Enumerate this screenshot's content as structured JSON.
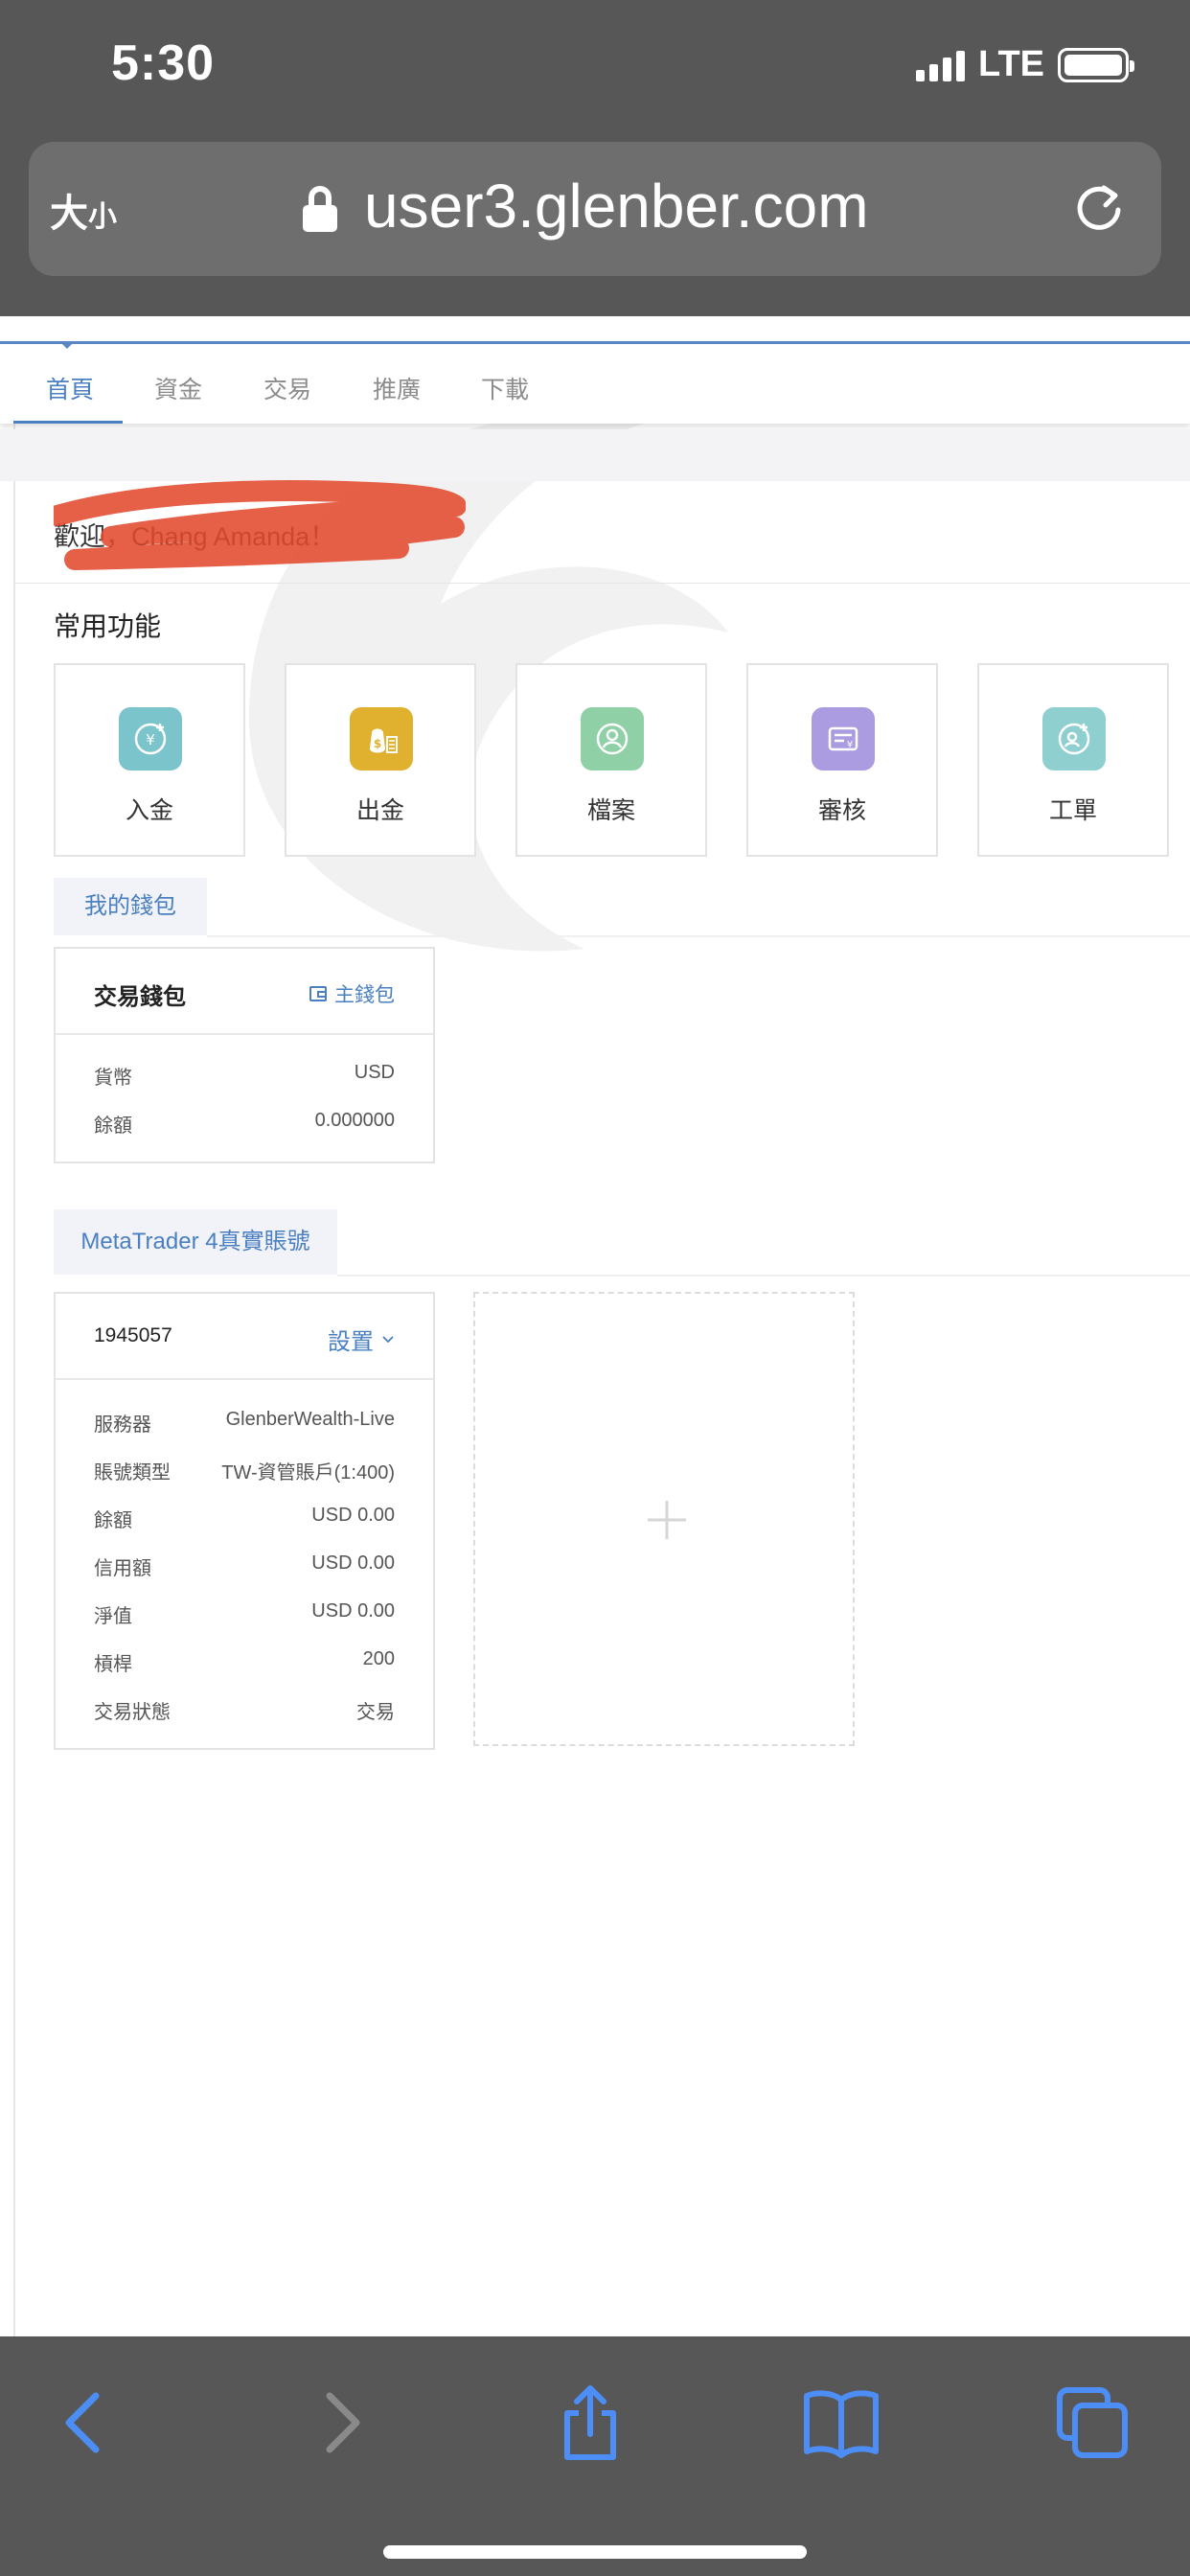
{
  "status_bar": {
    "time": "5:30",
    "network": "LTE"
  },
  "browser": {
    "size_toggle_big": "大",
    "size_toggle_small": "小",
    "url": "user3.glenber.com"
  },
  "nav": {
    "tabs": [
      {
        "label": "首頁",
        "active": true
      },
      {
        "label": "資金",
        "active": false
      },
      {
        "label": "交易",
        "active": false
      },
      {
        "label": "推廣",
        "active": false
      },
      {
        "label": "下載",
        "active": false
      }
    ]
  },
  "welcome_text": "歡迎，Chang Amanda！",
  "quick_functions": {
    "title": "常用功能",
    "items": [
      {
        "label": "入金",
        "icon": "deposit-icon",
        "color": "#7cc4cc"
      },
      {
        "label": "出金",
        "icon": "withdraw-icon",
        "color": "#e0b12e"
      },
      {
        "label": "檔案",
        "icon": "profile-icon",
        "color": "#8fd0a6"
      },
      {
        "label": "審核",
        "icon": "review-icon",
        "color": "#ab9be0"
      },
      {
        "label": "工單",
        "icon": "ticket-icon",
        "color": "#8fcfcf"
      }
    ]
  },
  "wallet": {
    "tab_label": "我的錢包",
    "card_title": "交易錢包",
    "link_label": "主錢包",
    "rows": [
      {
        "key": "貨幣",
        "value": "USD"
      },
      {
        "key": "餘額",
        "value": "0.000000"
      }
    ]
  },
  "mt4": {
    "tab_label": "MetaTrader 4真實賬號",
    "account_number": "1945057",
    "settings_label": "設置",
    "rows": [
      {
        "key": "服務器",
        "value": "GlenberWealth-Live"
      },
      {
        "key": "賬號類型",
        "value": "TW-資管賬戶(1:400)"
      },
      {
        "key": "餘額",
        "value": "USD 0.00"
      },
      {
        "key": "信用額",
        "value": "USD 0.00"
      },
      {
        "key": "淨值",
        "value": "USD 0.00"
      },
      {
        "key": "槓桿",
        "value": "200"
      },
      {
        "key": "交易狀態",
        "value": "交易"
      }
    ]
  },
  "colors": {
    "accent": "#4a7fc1",
    "browser_chrome": "#575757",
    "ios_blue": "#4c8ef5"
  }
}
